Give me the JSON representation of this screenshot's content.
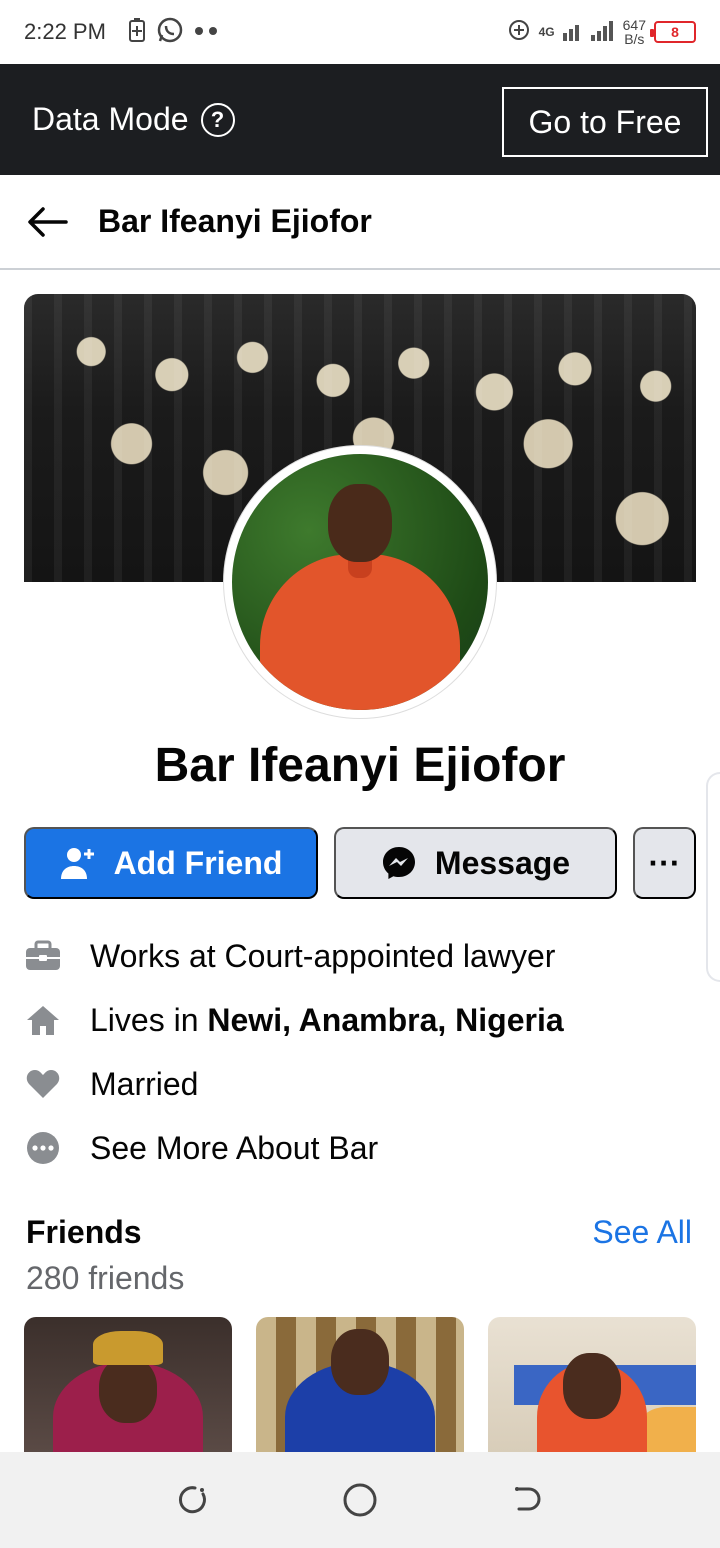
{
  "status_bar": {
    "time": "2:22 PM",
    "network": "4G",
    "speed_value": "647",
    "speed_unit": "B/s",
    "battery_level": "8",
    "icons": [
      "battery-saver-icon",
      "whatsapp-icon",
      "dots-icon",
      "data-saver-icon",
      "signal-icon",
      "battery-icon"
    ]
  },
  "data_bar": {
    "label": "Data Mode",
    "help_glyph": "?",
    "free_button": "Go to Free"
  },
  "header": {
    "title": "Bar Ifeanyi Ejiofor"
  },
  "profile": {
    "name": "Bar Ifeanyi Ejiofor",
    "actions": {
      "add_friend": "Add Friend",
      "message": "Message",
      "more": "···"
    },
    "about": {
      "work": "Works at Court-appointed lawyer",
      "lives_prefix": "Lives in ",
      "lives_place": "Newi, Anambra, Nigeria",
      "relationship": "Married",
      "see_more": "See More About Bar"
    }
  },
  "friends": {
    "title": "Friends",
    "count": "280 friends",
    "see_all": "See All"
  },
  "colors": {
    "accent": "#1b74e4",
    "data_bar": "#1c1e21",
    "secondary_button": "#e4e6eb",
    "muted_text": "#65676b"
  }
}
